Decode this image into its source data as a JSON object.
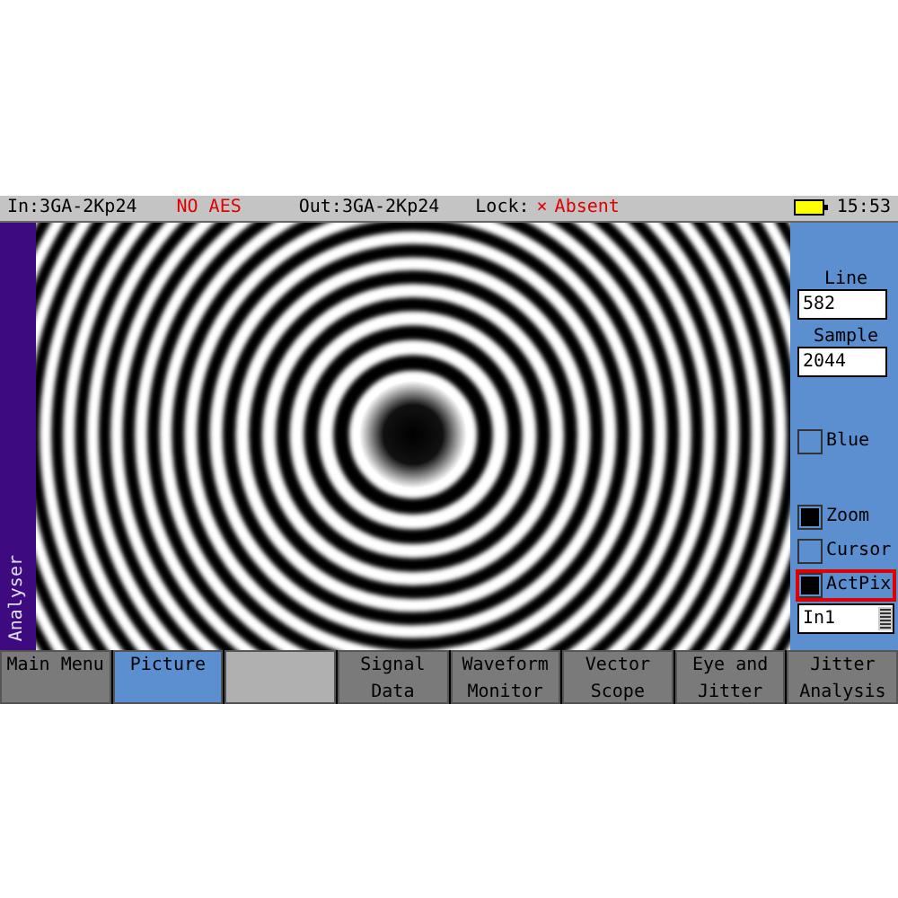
{
  "status_bar": {
    "input": "In:3GA-2Kp24",
    "audio": "NO AES",
    "output": "Out:3GA-2Kp24",
    "lock_label": "Lock:",
    "lock_mark": "×",
    "lock_value": "Absent",
    "time": "15:53"
  },
  "side_label": "Analyser",
  "panel": {
    "fields": [
      {
        "label": "Line",
        "value": "582"
      },
      {
        "label": "Sample",
        "value": "2044"
      }
    ],
    "options": [
      {
        "label": "Blue",
        "checked": false,
        "highlighted": false
      },
      {
        "label": "Zoom",
        "checked": true,
        "highlighted": false
      },
      {
        "label": "Cursor",
        "checked": false,
        "highlighted": false
      },
      {
        "label": "ActPix",
        "checked": true,
        "highlighted": true
      }
    ],
    "input_select": {
      "value": "In1"
    }
  },
  "menu": [
    {
      "lines": [
        "Main Menu"
      ],
      "selected": false,
      "kind": "button"
    },
    {
      "lines": [
        "Picture"
      ],
      "selected": true,
      "kind": "button"
    },
    {
      "selected": false,
      "kind": "blank"
    },
    {
      "lines": [
        "Signal",
        "Data"
      ],
      "selected": false,
      "kind": "button"
    },
    {
      "lines": [
        "Waveform",
        "Monitor"
      ],
      "selected": false,
      "kind": "button"
    },
    {
      "lines": [
        "Vector",
        "Scope"
      ],
      "selected": false,
      "kind": "button"
    },
    {
      "lines": [
        "Eye and",
        "Jitter"
      ],
      "selected": false,
      "kind": "button"
    },
    {
      "lines": [
        "Jitter",
        "Analysis"
      ],
      "selected": false,
      "kind": "button"
    }
  ]
}
